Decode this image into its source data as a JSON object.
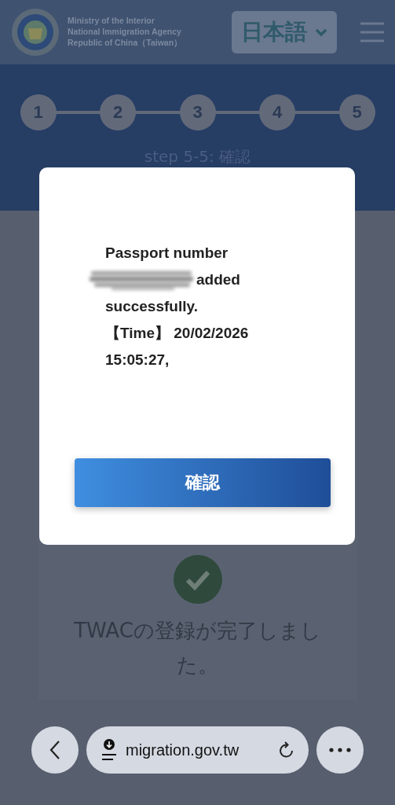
{
  "header": {
    "agency_lines": [
      "Ministry of the Interior",
      "National Immigration Agency",
      "Republic of China（Taiwan）"
    ],
    "language": "日本語"
  },
  "steps": [
    {
      "label": "1"
    },
    {
      "label": "2"
    },
    {
      "label": "3"
    },
    {
      "label": "4"
    },
    {
      "label": "5"
    }
  ],
  "step_title": "step 5-5: 確認",
  "result": {
    "message": "TWACの登録が完了しました。"
  },
  "modal": {
    "lines": [
      {
        "text": "Passport number",
        "redacted": false
      },
      {
        "text": "added",
        "redacted": true
      },
      {
        "text": "successfully.",
        "redacted": false
      },
      {
        "text": "【Time】 20/02/2026",
        "redacted": false
      },
      {
        "text": "15:05:27,",
        "redacted": false
      }
    ],
    "button": "確認"
  },
  "browser_bar": {
    "url": "migration.gov.tw"
  }
}
